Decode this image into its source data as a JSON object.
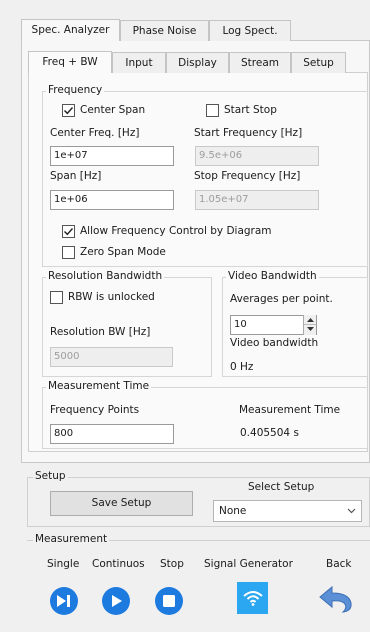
{
  "main_tabs": [
    {
      "label": "Spec. Analyzer",
      "active": true
    },
    {
      "label": "Phase Noise",
      "active": false
    },
    {
      "label": "Log Spect.",
      "active": false
    }
  ],
  "sub_tabs": [
    {
      "label": "Freq + BW",
      "active": true
    },
    {
      "label": "Input",
      "active": false
    },
    {
      "label": "Display",
      "active": false
    },
    {
      "label": "Stream",
      "active": false
    },
    {
      "label": "Setup",
      "active": false
    }
  ],
  "frequency": {
    "legend": "Frequency",
    "center_span": {
      "label": "Center Span",
      "checked": true
    },
    "start_stop": {
      "label": "Start Stop",
      "checked": false
    },
    "center_freq": {
      "label": "Center Freq. [Hz]",
      "value": "1e+07"
    },
    "span": {
      "label": "Span [Hz]",
      "value": "1e+06"
    },
    "start_freq": {
      "label": "Start Frequency [Hz]",
      "value": "9.5e+06"
    },
    "stop_freq": {
      "label": "Stop Frequency [Hz]",
      "value": "1.05e+07"
    },
    "allow_diagram": {
      "label": "Allow Frequency Control by Diagram",
      "checked": true
    },
    "zero_span": {
      "label": "Zero Span Mode",
      "checked": false
    }
  },
  "rbw": {
    "legend": "Resolution Bandwidth",
    "unlocked": {
      "label": "RBW is unlocked",
      "checked": false
    },
    "label": "Resolution BW [Hz]",
    "value": "5000"
  },
  "vbw": {
    "legend": "Video Bandwidth",
    "averages_label": "Averages per point.",
    "averages_value": "10",
    "vbw_label": "Video bandwidth",
    "vbw_value": "0 Hz"
  },
  "measurement_time": {
    "legend": "Measurement Time",
    "points_label": "Frequency Points",
    "points_value": "800",
    "time_label": "Measurement Time",
    "time_value": "0.405504 s"
  },
  "setup": {
    "legend": "Setup",
    "save_label": "Save Setup",
    "select_label": "Select Setup",
    "select_value": "None"
  },
  "measurement": {
    "legend": "Measurement",
    "single": "Single",
    "continuous": "Continuos",
    "stop": "Stop",
    "signal_generator": "Signal Generator",
    "back": "Back"
  },
  "colors": {
    "button_blue": "#1d7be0",
    "wifi_tile": "#2aa7f0",
    "back_arrow": "#5b8fd6"
  },
  "icons": [
    "checkmark-icon",
    "spin-up-icon",
    "spin-down-icon",
    "chevron-down-icon",
    "skip-play-icon",
    "play-icon",
    "stop-icon",
    "wifi-icon",
    "back-arrow-icon"
  ]
}
